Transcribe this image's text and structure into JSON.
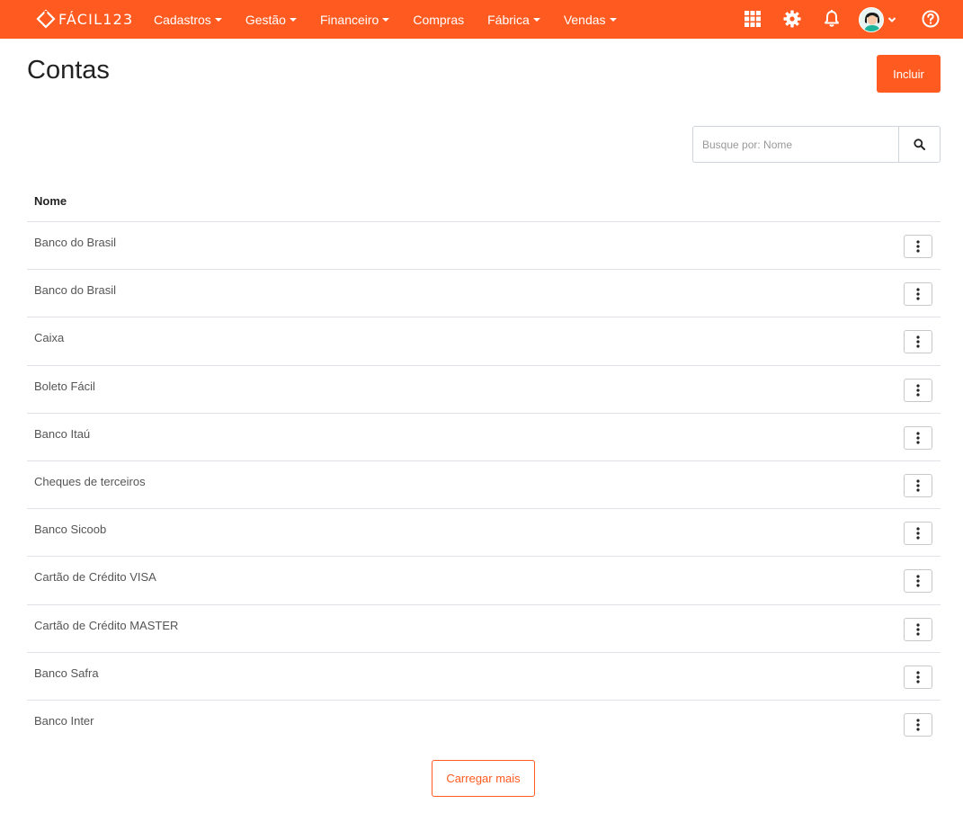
{
  "brand": {
    "name": "FÁCIL123"
  },
  "nav": {
    "items": [
      {
        "label": "Cadastros",
        "dropdown": true
      },
      {
        "label": "Gestão",
        "dropdown": true
      },
      {
        "label": "Financeiro",
        "dropdown": true
      },
      {
        "label": "Compras",
        "dropdown": false
      },
      {
        "label": "Fábrica",
        "dropdown": true
      },
      {
        "label": "Vendas",
        "dropdown": true
      }
    ],
    "right_icons": [
      "apps-grid-icon",
      "gear-icon",
      "bell-icon",
      "avatar",
      "help-icon"
    ]
  },
  "page": {
    "title": "Contas",
    "add_label": "Incluir"
  },
  "search": {
    "placeholder": "Busque por: Nome"
  },
  "table": {
    "header": "Nome",
    "rows": [
      "Banco do Brasil",
      "Banco do Brasil",
      "Caixa",
      "Boleto Fácil",
      "Banco Itaú",
      "Cheques de terceiros",
      "Banco Sicoob",
      "Cartão de Crédito VISA",
      "Cartão de Crédito MASTER",
      "Banco Safra",
      "Banco Inter"
    ]
  },
  "load_more_label": "Carregar mais",
  "colors": {
    "accent": "#ff5a1f"
  }
}
